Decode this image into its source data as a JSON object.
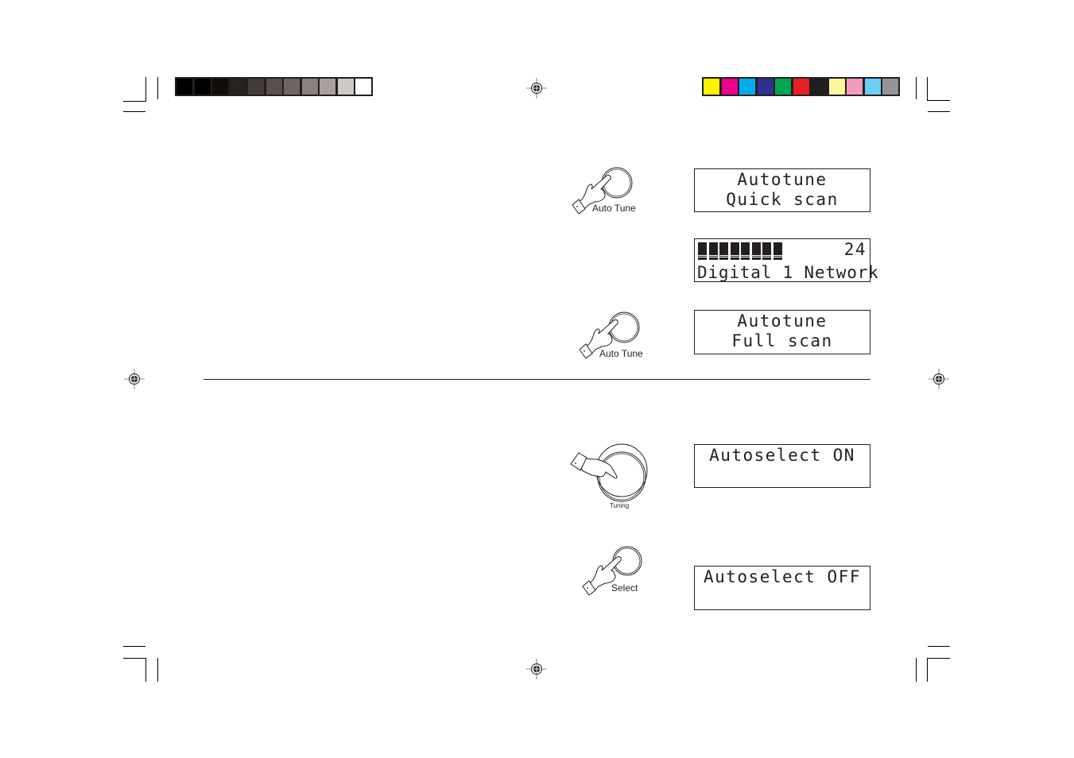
{
  "print_marks": {
    "grayscale_swatches": [
      "#000000",
      "#000000",
      "#120c08",
      "#28221f",
      "#433b39",
      "#57504d",
      "#6e6663",
      "#8a8280",
      "#a8a19f",
      "#cfcac8",
      "#ffffff"
    ],
    "color_swatches": [
      "#fff200",
      "#ec008c",
      "#00aeef",
      "#2e3192",
      "#00a651",
      "#ed1c24",
      "#231f20",
      "#fff799",
      "#f49ac1",
      "#6dcff6",
      "#939598"
    ]
  },
  "steps": [
    {
      "button": {
        "label": "Auto Tune",
        "icon": "hand-press-button-icon"
      },
      "display": {
        "line1": "Autotune",
        "line2": "Quick scan"
      }
    },
    {
      "display": {
        "progress_blocks": 8,
        "station_count": "24",
        "line2": "Digital 1 Network"
      }
    },
    {
      "button": {
        "label": "Auto Tune",
        "icon": "hand-press-button-icon"
      },
      "display": {
        "line1": "Autotune",
        "line2": "Full scan"
      }
    },
    {
      "button": {
        "label": "Tuning",
        "icon": "hand-turn-knob-icon"
      },
      "display": {
        "line1": "Autoselect ON",
        "line2": ""
      }
    },
    {
      "button": {
        "label": "Select",
        "icon": "hand-press-button-icon"
      },
      "display": {
        "line1": "Autoselect OFF",
        "line2": ""
      }
    }
  ]
}
